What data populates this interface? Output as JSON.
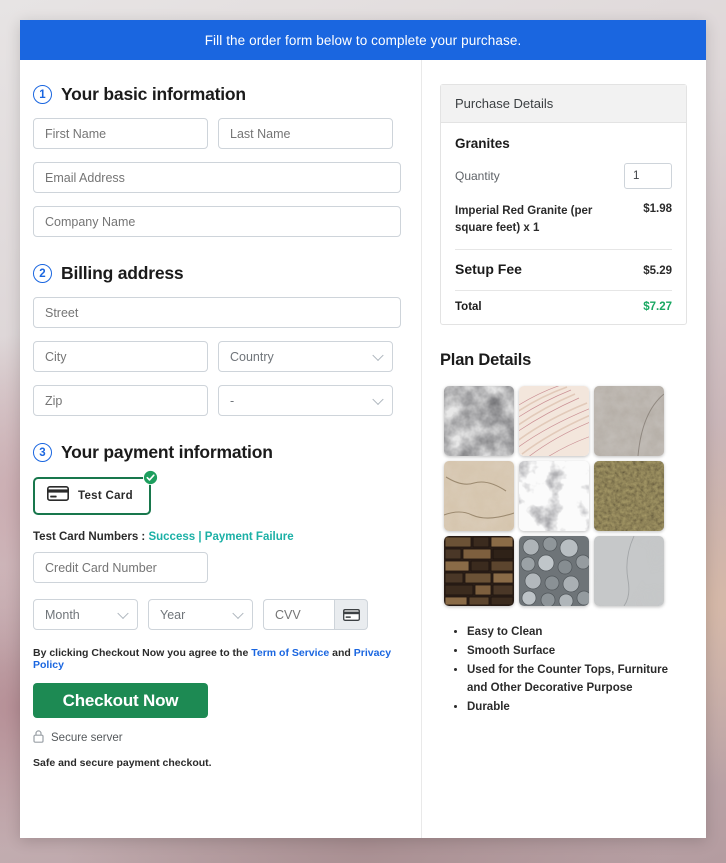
{
  "banner": {
    "text": "Fill the order form below to complete your purchase."
  },
  "sections": {
    "basic": {
      "number": "1",
      "title": "Your basic information",
      "first_name_placeholder": "First Name",
      "last_name_placeholder": "Last Name",
      "email_placeholder": "Email Address",
      "company_placeholder": "Company Name"
    },
    "billing": {
      "number": "2",
      "title": "Billing address",
      "street_placeholder": "Street",
      "city_placeholder": "City",
      "country_placeholder": "Country",
      "zip_placeholder": "Zip",
      "state_placeholder": "-"
    },
    "payment": {
      "number": "3",
      "title": "Your payment information",
      "method_label": "Test  Card",
      "method_icon": "credit-card-icon",
      "selected_icon": "check-circle-icon",
      "test_cards_label": "Test Card Numbers :",
      "test_card_success": "Success",
      "test_card_separator": "|",
      "test_card_failure": "Payment Failure",
      "card_number_placeholder": "Credit Card Number",
      "month_placeholder": "Month",
      "year_placeholder": "Year",
      "cvv_placeholder": "CVV",
      "cvv_icon": "credit-card-icon",
      "terms_prefix": "By clicking Checkout Now you agree to the",
      "terms_link": "Term of Service",
      "terms_and": "and",
      "privacy_link": "Privacy Policy",
      "checkout_label": "Checkout Now",
      "secure_icon": "lock-icon",
      "secure_label": "Secure server",
      "safe_note": "Safe and secure payment checkout."
    }
  },
  "purchase": {
    "header": "Purchase Details",
    "product": "Granites",
    "quantity_label": "Quantity",
    "quantity_value": "1",
    "line_item": {
      "description": "Imperial Red Granite (per square feet) x 1",
      "amount": "$1.98"
    },
    "setup_fee": {
      "label": "Setup Fee",
      "amount": "$5.29"
    },
    "total": {
      "label": "Total",
      "amount": "$7.27"
    }
  },
  "plan": {
    "title": "Plan Details",
    "swatches": [
      {
        "name": "black-marble-swatch"
      },
      {
        "name": "cream-veined-marble-swatch"
      },
      {
        "name": "gray-concrete-swatch"
      },
      {
        "name": "beige-cracked-stone-swatch"
      },
      {
        "name": "white-marble-swatch"
      },
      {
        "name": "dark-gold-speckled-granite-swatch"
      },
      {
        "name": "brown-brick-stone-swatch"
      },
      {
        "name": "gray-pebble-swatch"
      },
      {
        "name": "light-gray-slate-swatch"
      }
    ],
    "features": [
      "Easy to Clean",
      "Smooth Surface",
      "Used for the Counter Tops, Furniture and Other Decorative Purpose",
      "Durable"
    ]
  },
  "colors": {
    "banner_blue": "#1a66e0",
    "checkout_green": "#1d8a53",
    "badge_green": "#18774c",
    "total_green": "#19a862",
    "link_teal": "#1bb0a6",
    "link_blue": "#1a66e0"
  }
}
